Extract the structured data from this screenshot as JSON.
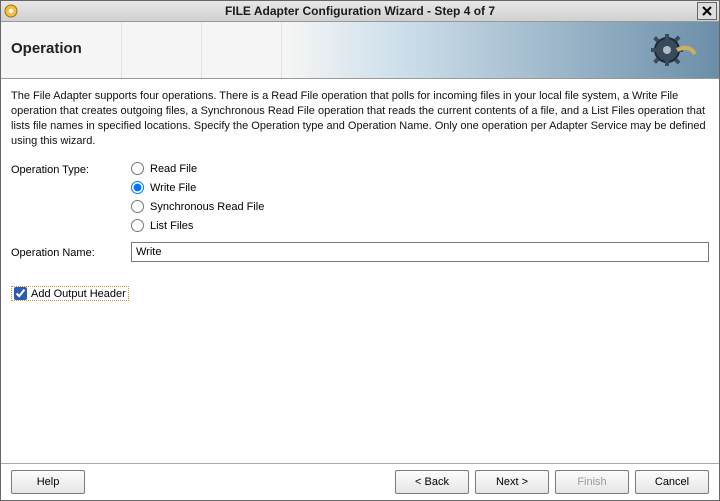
{
  "window": {
    "title": "FILE Adapter Configuration Wizard - Step 4 of 7"
  },
  "banner": {
    "heading": "Operation"
  },
  "description": "The File Adapter supports four operations.  There is a Read File operation that polls for incoming files in your local file system, a Write File operation that creates outgoing files, a Synchronous Read File operation that reads the current contents of a file, and a List Files operation that lists file names in specified locations.  Specify the Operation type and Operation Name.  Only one operation per Adapter Service may be defined using this wizard.",
  "labels": {
    "operation_type": "Operation Type:",
    "operation_name": "Operation Name:"
  },
  "operation_type": {
    "options": {
      "read": "Read File",
      "write": "Write File",
      "sync_read": "Synchronous Read File",
      "list": "List Files"
    },
    "selected": "write"
  },
  "operation_name": {
    "value": "Write"
  },
  "add_output_header": {
    "label": "Add Output Header",
    "checked": true
  },
  "buttons": {
    "help": "Help",
    "back": "< Back",
    "next": "Next >",
    "finish": "Finish",
    "cancel": "Cancel"
  }
}
